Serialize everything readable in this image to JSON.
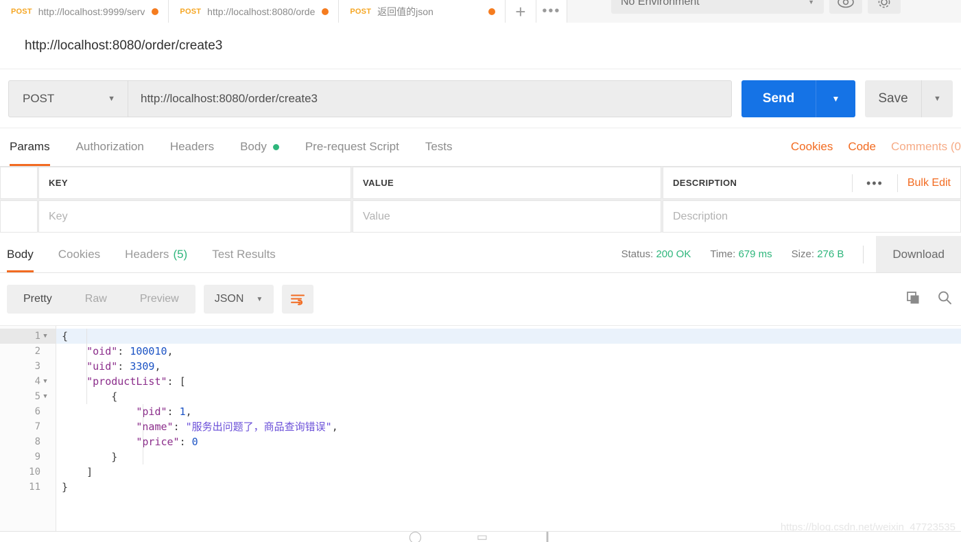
{
  "tabstrip": {
    "tabs": [
      {
        "verb": "POST",
        "name": "http://localhost:9999/serv",
        "dirty": true,
        "active": false
      },
      {
        "verb": "POST",
        "name": "http://localhost:8080/orde",
        "dirty": true,
        "active": true
      },
      {
        "verb": "POST",
        "name": "返回值的json",
        "dirty": true,
        "active": false
      }
    ],
    "new_tab_icon": "plus-icon",
    "more_icon": "ellipsis-icon",
    "environment": {
      "selected": "No Environment",
      "caret_icon": "chevron-down-icon",
      "eye_icon": "eye-icon"
    }
  },
  "request": {
    "name": "http://localhost:8080/order/create3",
    "method": "POST",
    "method_caret_icon": "chevron-down-icon",
    "url": "http://localhost:8080/order/create3",
    "send_label": "Send",
    "send_caret_icon": "chevron-down-icon",
    "save_label": "Save",
    "save_caret_icon": "chevron-down-icon",
    "tabs": [
      {
        "label": "Params",
        "active": true,
        "dot": false
      },
      {
        "label": "Authorization",
        "active": false,
        "dot": false
      },
      {
        "label": "Headers",
        "active": false,
        "dot": false
      },
      {
        "label": "Body",
        "active": false,
        "dot": true
      },
      {
        "label": "Pre-request Script",
        "active": false,
        "dot": false
      },
      {
        "label": "Tests",
        "active": false,
        "dot": false
      }
    ],
    "links": {
      "cookies": "Cookies",
      "code": "Code",
      "comments": "Comments (0"
    }
  },
  "params_table": {
    "headers": {
      "key": "KEY",
      "value": "VALUE",
      "description": "DESCRIPTION"
    },
    "placeholders": {
      "key": "Key",
      "value": "Value",
      "description": "Description"
    },
    "tools": {
      "more_icon": "ellipsis-icon",
      "bulk_edit": "Bulk Edit"
    }
  },
  "response": {
    "tabs": [
      {
        "label": "Body",
        "active": true,
        "count": ""
      },
      {
        "label": "Cookies",
        "active": false,
        "count": ""
      },
      {
        "label": "Headers",
        "active": false,
        "count": "(5)"
      },
      {
        "label": "Test Results",
        "active": false,
        "count": ""
      }
    ],
    "stats": [
      {
        "label": "Status:",
        "value": "200 OK"
      },
      {
        "label": "Time:",
        "value": "679 ms"
      },
      {
        "label": "Size:",
        "value": "276 B"
      }
    ],
    "download_label": "Download",
    "toolbar": {
      "modes": [
        {
          "label": "Pretty",
          "active": true
        },
        {
          "label": "Raw",
          "active": false
        },
        {
          "label": "Preview",
          "active": false
        }
      ],
      "format": "JSON",
      "format_caret_icon": "chevron-down-icon",
      "wrap_icon": "word-wrap-icon",
      "copy_icon": "copy-icon",
      "search_icon": "search-icon"
    },
    "code": {
      "lines": [
        {
          "num": "1",
          "fold": true,
          "highlight": true,
          "tokens": [
            {
              "t": "x",
              "v": "{"
            }
          ]
        },
        {
          "num": "2",
          "fold": false,
          "highlight": false,
          "tokens": [
            {
              "t": "x",
              "v": "    "
            },
            {
              "t": "p",
              "v": "\"oid\""
            },
            {
              "t": "x",
              "v": ": "
            },
            {
              "t": "n",
              "v": "100010"
            },
            {
              "t": "x",
              "v": ","
            }
          ]
        },
        {
          "num": "3",
          "fold": false,
          "highlight": false,
          "tokens": [
            {
              "t": "x",
              "v": "    "
            },
            {
              "t": "p",
              "v": "\"uid\""
            },
            {
              "t": "x",
              "v": ": "
            },
            {
              "t": "n",
              "v": "3309"
            },
            {
              "t": "x",
              "v": ","
            }
          ]
        },
        {
          "num": "4",
          "fold": true,
          "highlight": false,
          "tokens": [
            {
              "t": "x",
              "v": "    "
            },
            {
              "t": "p",
              "v": "\"productList\""
            },
            {
              "t": "x",
              "v": ": ["
            }
          ]
        },
        {
          "num": "5",
          "fold": true,
          "highlight": false,
          "tokens": [
            {
              "t": "x",
              "v": "        {"
            }
          ]
        },
        {
          "num": "6",
          "fold": false,
          "highlight": false,
          "tokens": [
            {
              "t": "x",
              "v": "            "
            },
            {
              "t": "p",
              "v": "\"pid\""
            },
            {
              "t": "x",
              "v": ": "
            },
            {
              "t": "n",
              "v": "1"
            },
            {
              "t": "x",
              "v": ","
            }
          ]
        },
        {
          "num": "7",
          "fold": false,
          "highlight": false,
          "tokens": [
            {
              "t": "x",
              "v": "            "
            },
            {
              "t": "p",
              "v": "\"name\""
            },
            {
              "t": "x",
              "v": ": "
            },
            {
              "t": "s",
              "v": "\"服务出问题了，商品查询错误\""
            },
            {
              "t": "x",
              "v": ","
            }
          ]
        },
        {
          "num": "8",
          "fold": false,
          "highlight": false,
          "tokens": [
            {
              "t": "x",
              "v": "            "
            },
            {
              "t": "p",
              "v": "\"price\""
            },
            {
              "t": "x",
              "v": ": "
            },
            {
              "t": "n",
              "v": "0"
            }
          ]
        },
        {
          "num": "9",
          "fold": false,
          "highlight": false,
          "tokens": [
            {
              "t": "x",
              "v": "        }"
            }
          ]
        },
        {
          "num": "10",
          "fold": false,
          "highlight": false,
          "tokens": [
            {
              "t": "x",
              "v": "    ]"
            }
          ]
        },
        {
          "num": "11",
          "fold": false,
          "highlight": false,
          "tokens": [
            {
              "t": "x",
              "v": "}"
            }
          ]
        }
      ]
    }
  },
  "watermark": "https://blog.csdn.net/weixin_47723535",
  "colors": {
    "accent_orange": "#f26b21",
    "send_blue": "#1573e6",
    "status_green": "#2fb67c",
    "method_orange": "#f5a623",
    "dirty_dot": "#f57c1f"
  }
}
